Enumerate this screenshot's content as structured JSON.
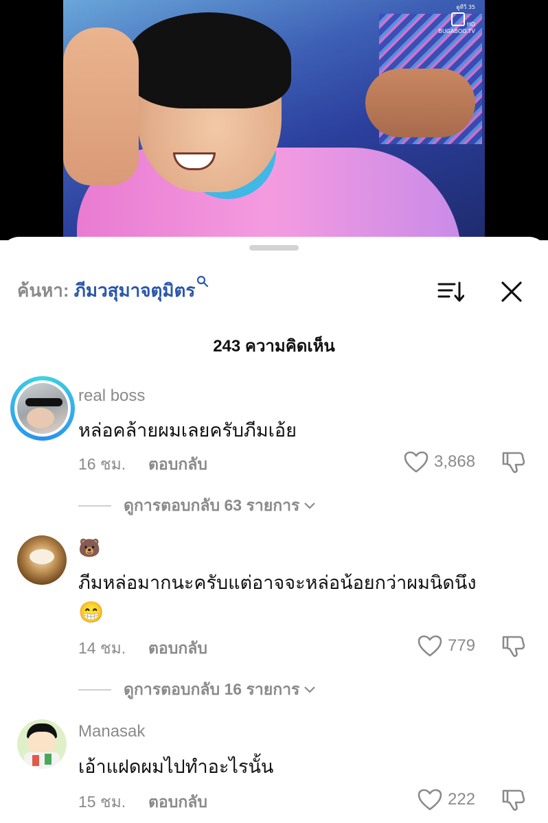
{
  "search": {
    "prefix": "ค้นหา:",
    "term": "ภีมวสุมาจตุมิตร"
  },
  "comments_count": "243 ความคิดเห็น",
  "video": {
    "channel_label": "ดูทีวี 35",
    "brand": "BUGABOO.TV",
    "hd": "HD"
  },
  "comments": [
    {
      "username": "real boss",
      "text": "หล่อคล้ายผมเลยครับภีมเอ้ย",
      "time": "16 ชม.",
      "reply_label": "ตอบกลับ",
      "likes": "3,868",
      "view_replies": "ดูการตอบกลับ 63 รายการ",
      "avatar": "sunglasses-portrait"
    },
    {
      "username": "🐻",
      "text": "ภีมหล่อมากนะครับแต่อาจจะหล่อน้อยกว่าผมนิดนึง",
      "text_emoji": "😁",
      "time": "14 ชม.",
      "reply_label": "ตอบกลับ",
      "likes": "779",
      "view_replies": "ดูการตอบกลับ 16 รายการ",
      "avatar": "food-bowl"
    },
    {
      "username": "Manasak",
      "text": "เอ้าแฝดผมไปทำอะไรนั้น",
      "time": "15 ชม.",
      "reply_label": "ตอบกลับ",
      "likes": "222",
      "avatar": "cartoon-boy"
    }
  ]
}
